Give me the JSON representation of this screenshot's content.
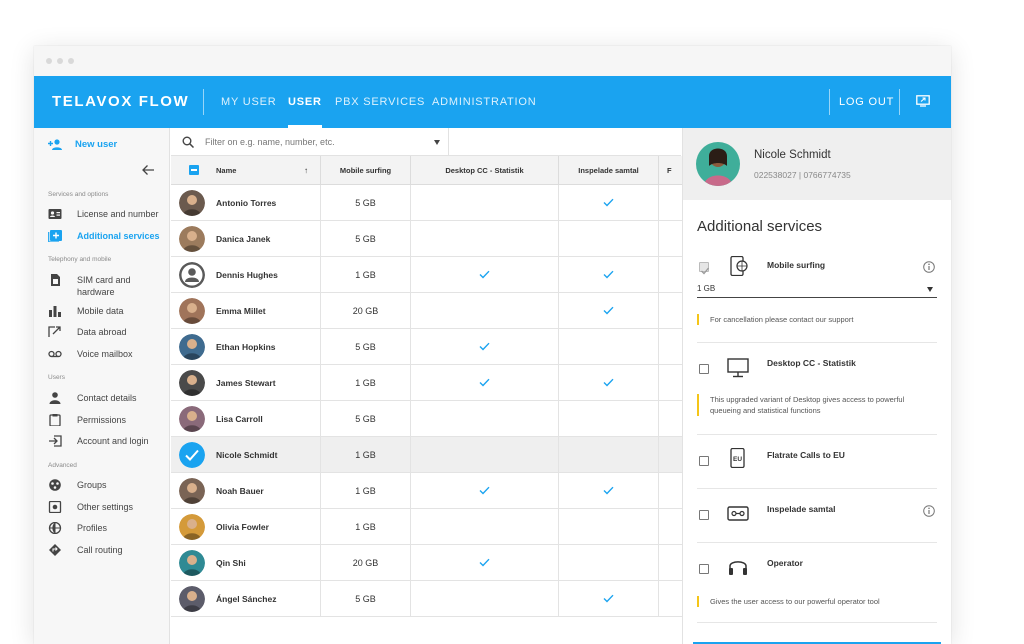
{
  "app": {
    "brand": "TELAVOX FLOW",
    "nav": [
      "MY USER",
      "USER",
      "PBX SERVICES",
      "ADMINISTRATION"
    ],
    "active_nav": "USER",
    "logout": "LOG OUT",
    "accent": "#1aa3f0"
  },
  "sidebar": {
    "new_user": "New user",
    "sections": [
      {
        "title": "Services and options",
        "items": [
          {
            "label": "License and number",
            "icon": "id-card-icon"
          },
          {
            "label": "Additional services",
            "icon": "add-box-icon",
            "active": true
          }
        ]
      },
      {
        "title": "Telephony and mobile",
        "items": [
          {
            "label": "SIM card and hardware",
            "icon": "sim-card-icon"
          },
          {
            "label": "Mobile data",
            "icon": "bar-chart-icon"
          },
          {
            "label": "Data abroad",
            "icon": "share-icon"
          },
          {
            "label": "Voice mailbox",
            "icon": "voicemail-icon"
          }
        ]
      },
      {
        "title": "Users",
        "items": [
          {
            "label": "Contact details",
            "icon": "person-icon"
          },
          {
            "label": "Permissions",
            "icon": "clipboard-icon"
          },
          {
            "label": "Account and login",
            "icon": "login-icon"
          }
        ]
      },
      {
        "title": "Advanced",
        "items": [
          {
            "label": "Groups",
            "icon": "groups-icon"
          },
          {
            "label": "Other settings",
            "icon": "settings-icon"
          },
          {
            "label": "Profiles",
            "icon": "globe-icon"
          },
          {
            "label": "Call routing",
            "icon": "routing-icon"
          }
        ]
      }
    ]
  },
  "filter": {
    "placeholder": "Filter on e.g. name, number, etc."
  },
  "table": {
    "columns": [
      "Name",
      "Mobile surfing",
      "Desktop CC - Statistik",
      "Inspelade samtal",
      "F"
    ],
    "rows": [
      {
        "name": "Antonio Torres",
        "mobile": "5 GB",
        "desktop": false,
        "inspelade": true,
        "avatar": "#6b5a4e"
      },
      {
        "name": "Danica Janek",
        "mobile": "5 GB",
        "desktop": false,
        "inspelade": false,
        "avatar": "#9c7b5d"
      },
      {
        "name": "Dennis Hughes",
        "mobile": "1 GB",
        "desktop": true,
        "inspelade": true,
        "avatar": "#6f6f6f",
        "placeholder": true
      },
      {
        "name": "Emma Millet",
        "mobile": "20 GB",
        "desktop": false,
        "inspelade": true,
        "avatar": "#a0745a"
      },
      {
        "name": "Ethan Hopkins",
        "mobile": "5 GB",
        "desktop": true,
        "inspelade": false,
        "avatar": "#3f6b8f"
      },
      {
        "name": "James Stewart",
        "mobile": "1 GB",
        "desktop": true,
        "inspelade": true,
        "avatar": "#4a4a4a"
      },
      {
        "name": "Lisa Carroll",
        "mobile": "5 GB",
        "desktop": false,
        "inspelade": false,
        "avatar": "#8a6a7a"
      },
      {
        "name": "Nicole Schmidt",
        "mobile": "1 GB",
        "desktop": false,
        "inspelade": false,
        "avatar": "#1aa3f0",
        "selected": true
      },
      {
        "name": "Noah Bauer",
        "mobile": "1 GB",
        "desktop": true,
        "inspelade": true,
        "avatar": "#7a6455"
      },
      {
        "name": "Olivia Fowler",
        "mobile": "1 GB",
        "desktop": false,
        "inspelade": false,
        "avatar": "#d49a3a"
      },
      {
        "name": "Qin Shi",
        "mobile": "20 GB",
        "desktop": true,
        "inspelade": false,
        "avatar": "#2f8a94"
      },
      {
        "name": "Ángel Sánchez",
        "mobile": "5 GB",
        "desktop": false,
        "inspelade": true,
        "avatar": "#5c5c6a"
      }
    ]
  },
  "panel": {
    "user_name": "Nicole Schmidt",
    "user_phone": "022538027 | 0766774735",
    "title": "Additional services",
    "services": [
      {
        "label": "Mobile surfing",
        "icon": "mobile-globe-icon",
        "checked": true,
        "info": true,
        "select_value": "1 GB",
        "note": "For cancellation please contact our support"
      },
      {
        "label": "Desktop CC - Statistik",
        "icon": "monitor-icon",
        "checked": false,
        "info": false,
        "note": "This upgraded variant of Desktop gives access to powerful queueing and statistical functions"
      },
      {
        "label": "Flatrate Calls to EU",
        "icon": "mobile-eu-icon",
        "checked": false,
        "info": false,
        "icon_text": "EU"
      },
      {
        "label": "Inspelade samtal",
        "icon": "cassette-icon",
        "checked": false,
        "info": true
      },
      {
        "label": "Operator",
        "icon": "headset-icon",
        "checked": false,
        "info": false,
        "note": "Gives the user access to our powerful operator tool"
      }
    ]
  }
}
